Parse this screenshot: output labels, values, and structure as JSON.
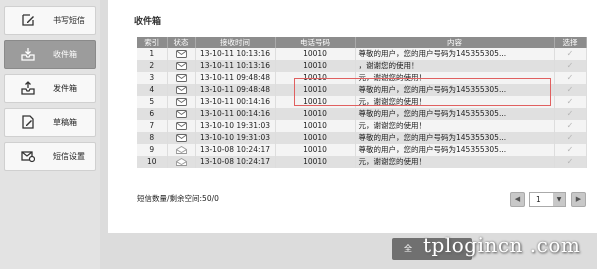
{
  "sidebar": {
    "items": [
      {
        "label": "书写短信",
        "icon": "compose-icon",
        "active": false
      },
      {
        "label": "收件箱",
        "icon": "inbox-icon",
        "active": true
      },
      {
        "label": "发件箱",
        "icon": "outbox-icon",
        "active": false
      },
      {
        "label": "草稿箱",
        "icon": "drafts-icon",
        "active": false
      },
      {
        "label": "短信设置",
        "icon": "settings-icon",
        "active": false
      }
    ]
  },
  "main": {
    "title": "收件箱",
    "columns": [
      "索引",
      "状态",
      "接收时间",
      "电话号码",
      "内容",
      "选择"
    ],
    "rows": [
      {
        "index": "1",
        "time": "13-10-11 10:13:16",
        "phone": "10010",
        "content": "尊敬的用户，您的用户号码为145355305...",
        "read": true
      },
      {
        "index": "2",
        "time": "13-10-11 10:13:16",
        "phone": "10010",
        "content": "，谢谢您的使用！",
        "read": true
      },
      {
        "index": "3",
        "time": "13-10-11 09:48:48",
        "phone": "10010",
        "content": "元，谢谢您的使用！",
        "read": true
      },
      {
        "index": "4",
        "time": "13-10-11 09:48:48",
        "phone": "10010",
        "content": "尊敬的用户，您的用户号码为145355305...",
        "read": true
      },
      {
        "index": "5",
        "time": "13-10-11 00:14:16",
        "phone": "10010",
        "content": "元，谢谢您的使用！",
        "read": true
      },
      {
        "index": "6",
        "time": "13-10-11 00:14:16",
        "phone": "10010",
        "content": "尊敬的用户，您的用户号码为145355305...",
        "read": true
      },
      {
        "index": "7",
        "time": "13-10-10 19:31:03",
        "phone": "10010",
        "content": "元，谢谢您的使用！",
        "read": true
      },
      {
        "index": "8",
        "time": "13-10-10 19:31:03",
        "phone": "10010",
        "content": "尊敬的用户，您的用户号码为145355305...",
        "read": true
      },
      {
        "index": "9",
        "time": "13-10-08 10:24:17",
        "phone": "10010",
        "content": "尊敬的用户，您的用户号码为145355305...",
        "read": false
      },
      {
        "index": "10",
        "time": "13-10-08 10:24:17",
        "phone": "10010",
        "content": "元，谢谢您的使用！",
        "read": false
      }
    ],
    "count_text": "短信数量/剩余空间:50/0",
    "page_selected": "1",
    "bottom_button_label": "全"
  },
  "watermark": "tplogincn .com",
  "colors": {
    "header_bg": "#8c8c8c",
    "active_sidebar": "#9c9c9c",
    "highlight_border": "#e06060"
  }
}
